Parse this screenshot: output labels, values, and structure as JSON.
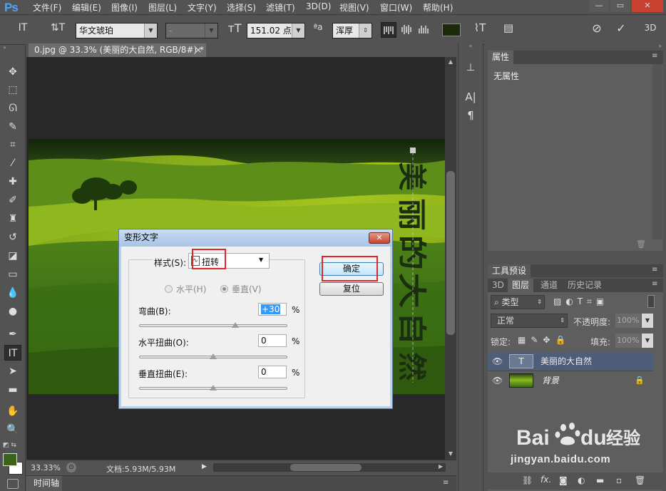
{
  "app": {
    "logo": "Ps"
  },
  "menu": [
    "文件(F)",
    "编辑(E)",
    "图像(I)",
    "图层(L)",
    "文字(Y)",
    "选择(S)",
    "滤镜(T)",
    "3D(D)",
    "视图(V)",
    "窗口(W)",
    "帮助(H)"
  ],
  "window_controls": {
    "minimize": "—",
    "restore": "▭",
    "close": "✕"
  },
  "options": {
    "font_family": "华文琥珀",
    "font_style": "-",
    "font_size": "151.02 点",
    "aa_label": "ªa",
    "antialias": "浑厚",
    "text_color": "#1a2a0a",
    "mode_3d": "3D"
  },
  "document": {
    "tab_title": "0.jpg @ 33.3% (美丽的大自然, RGB/8#) *",
    "tab_close": "×",
    "warped_text": "美丽的大自然",
    "text_color": "#1a2e10"
  },
  "status": {
    "zoom": "33.33%",
    "doc_info": "文档:5.93M/5.93M"
  },
  "timeline": {
    "label": "时间轴"
  },
  "properties_panel": {
    "tab": "属性",
    "content": "无属性"
  },
  "tool_presets": {
    "tab": "工具预设"
  },
  "layers_panel": {
    "tabs": [
      "3D",
      "图层",
      "通道",
      "历史记录"
    ],
    "filter_kind": "类型",
    "blend_mode": "正常",
    "opacity_label": "不透明度:",
    "opacity": "100%",
    "lock_label": "锁定:",
    "fill_label": "填充:",
    "fill": "100%",
    "layers": [
      {
        "name": "美丽的大自然",
        "thumb": "T",
        "selected": true
      },
      {
        "name": "背景",
        "thumb": "",
        "selected": false
      }
    ],
    "bottom_icons": [
      "link-icon",
      "fx-icon",
      "mask-icon",
      "adjustment-icon",
      "folder-icon",
      "new-layer-icon",
      "trash-icon"
    ],
    "fx_label": "fx."
  },
  "dialog": {
    "title": "变形文字",
    "close": "✕",
    "style_label": "样式(S):",
    "style_value": "扭转",
    "orientation": {
      "horizontal": "水平(H)",
      "vertical": "垂直(V)",
      "selected": "vertical"
    },
    "bend_label": "弯曲(B):",
    "bend_value": "+30",
    "bend": 30,
    "h_distort_label": "水平扭曲(O):",
    "h_distort_value": "0",
    "h_distort": 0,
    "v_distort_label": "垂直扭曲(E):",
    "v_distort_value": "0",
    "v_distort": 0,
    "percent": "%",
    "ok": "确定",
    "reset": "复位"
  },
  "watermark": {
    "brand": "Baidu经验",
    "url": "jingyan.baidu.com"
  }
}
